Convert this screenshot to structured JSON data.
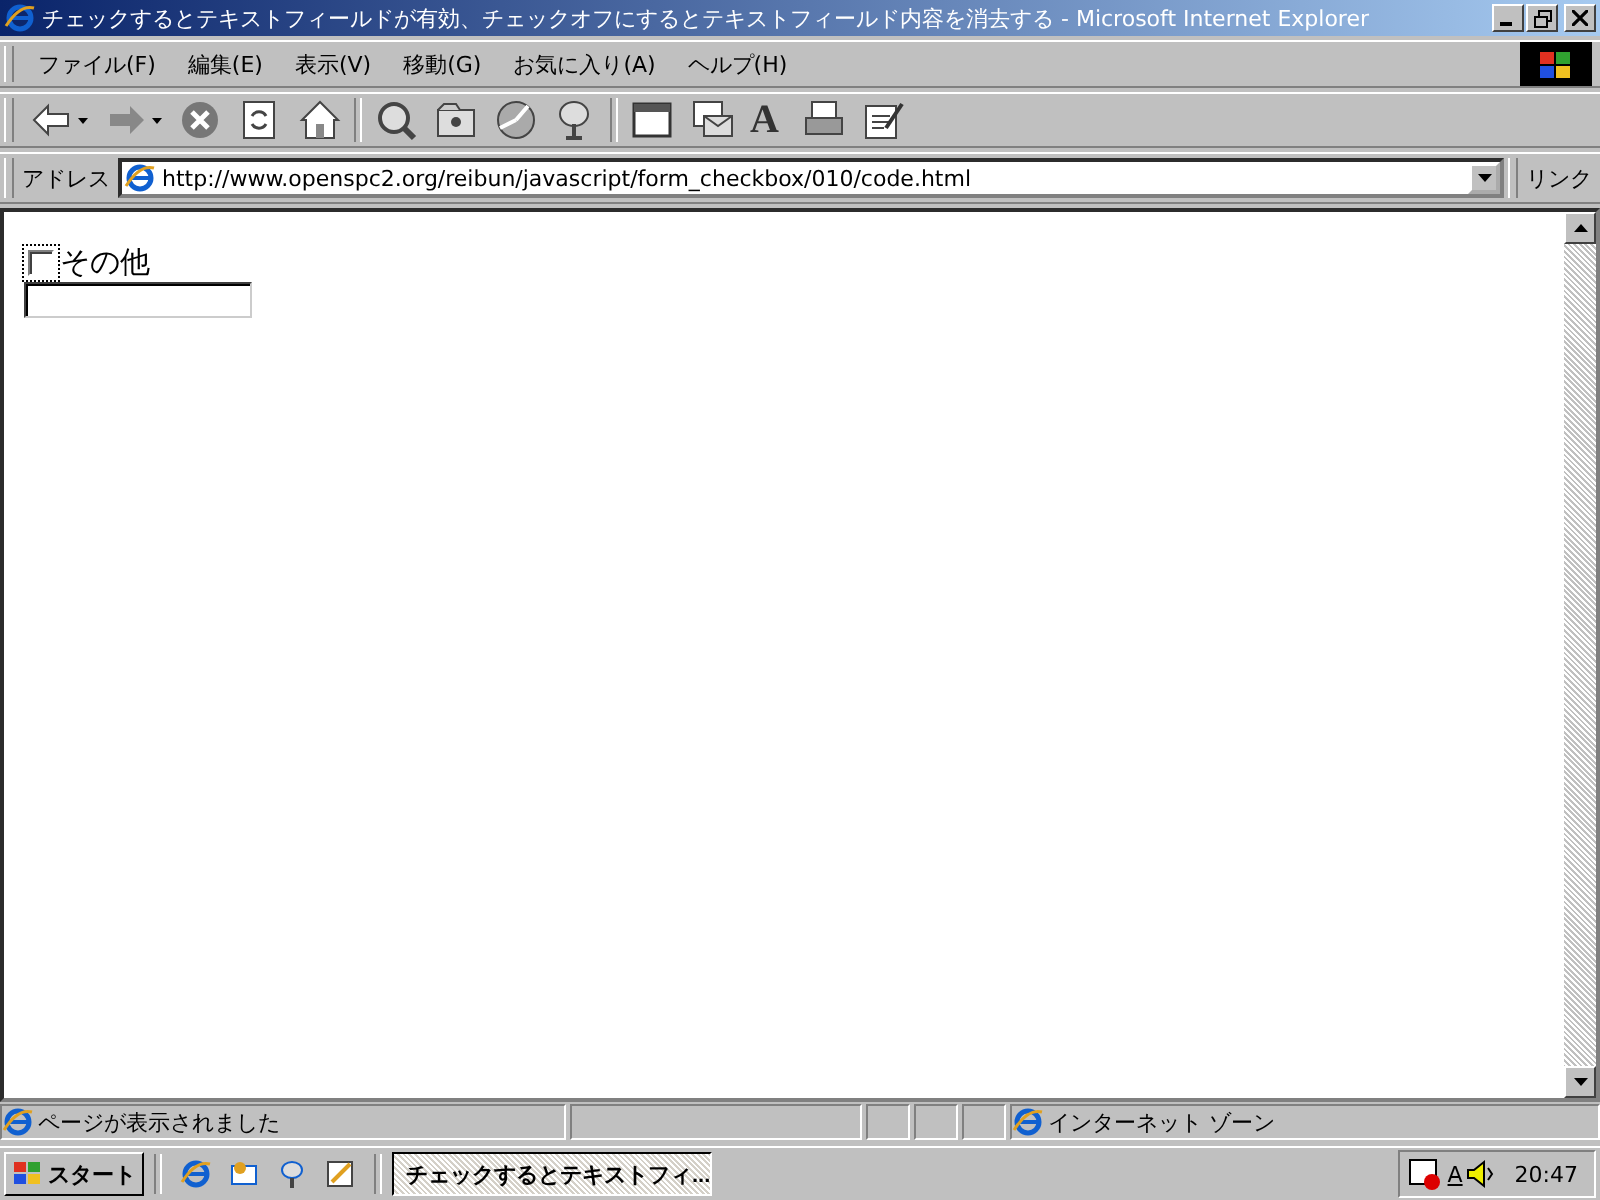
{
  "window": {
    "title": "チェックするとテキストフィールドが有効、チェックオフにするとテキストフィールド内容を消去する - Microsoft Internet Explorer"
  },
  "menu": [
    "ファイル(F)",
    "編集(E)",
    "表示(V)",
    "移動(G)",
    "お気に入り(A)",
    "ヘルプ(H)"
  ],
  "toolbar": [
    {
      "kind": "back",
      "dropdown": true
    },
    {
      "kind": "forward",
      "dropdown": true
    },
    {
      "kind": "stop"
    },
    {
      "kind": "refresh"
    },
    {
      "kind": "home"
    },
    {
      "kind": "sep"
    },
    {
      "kind": "search"
    },
    {
      "kind": "favorites"
    },
    {
      "kind": "history"
    },
    {
      "kind": "channels"
    },
    {
      "kind": "sep"
    },
    {
      "kind": "window"
    },
    {
      "kind": "mail"
    },
    {
      "kind": "font",
      "glyph": "A"
    },
    {
      "kind": "print"
    },
    {
      "kind": "edit"
    }
  ],
  "address": {
    "label": "アドレス",
    "url": "http://www.openspc2.org/reibun/javascript/form_checkbox/010/code.html",
    "links": "リンク"
  },
  "form": {
    "checkbox": {
      "label": "その他",
      "checked": false,
      "focused": true
    }
  },
  "status_bar": {
    "text": "ページが表示されました",
    "zone": "インターネット ゾーン"
  },
  "taskbar": {
    "start": "スタート",
    "tasks": [
      {
        "label": "チェックするとテキストフィ...",
        "selected": true
      }
    ],
    "ime": "A",
    "clock": "20:47"
  }
}
